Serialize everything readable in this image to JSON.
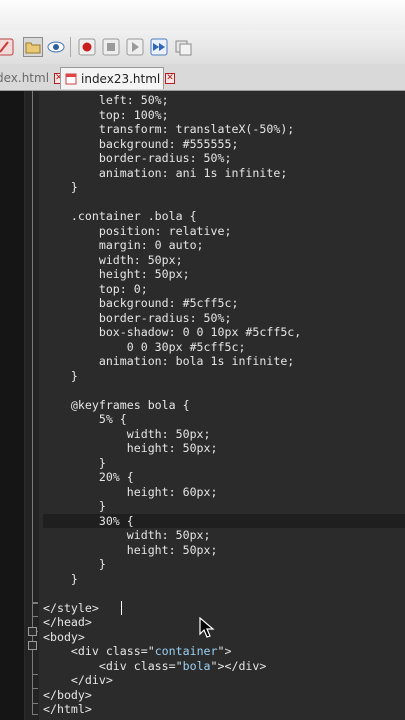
{
  "tabs": [
    {
      "label": "dex.html",
      "active": false,
      "icon": "html-file-icon"
    },
    {
      "label": "index23.html",
      "active": true,
      "icon": "html-file-icon"
    }
  ],
  "toolbar": {
    "icons": [
      "edit-icon",
      "open-folder-icon",
      "view-eye-icon",
      "record-icon",
      "stop-icon",
      "play-icon",
      "fast-forward-icon",
      "save-macro-icon"
    ]
  },
  "code_lines": [
    "        left: 50%;",
    "        top: 100%;",
    "        transform: translateX(-50%);",
    "        background: #555555;",
    "        border-radius: 50%;",
    "        animation: ani 1s infinite;",
    "    }",
    "",
    "    .container .bola {",
    "        position: relative;",
    "        margin: 0 auto;",
    "        width: 50px;",
    "        height: 50px;",
    "        top: 0;",
    "        background: #5cff5c;",
    "        border-radius: 50%;",
    "        box-shadow: 0 0 10px #5cff5c,",
    "            0 0 30px #5cff5c;",
    "        animation: bola 1s infinite;",
    "    }",
    "",
    "    @keyframes bola {",
    "        5% {",
    "            width: 50px;",
    "            height: 50px;",
    "        }",
    "        20% {",
    "            height: 60px;",
    "        }",
    "        30% {",
    "            width: 50px;",
    "            height: 50px;",
    "        }",
    "    }",
    "",
    "</style>",
    "</head>",
    "<body>",
    "    <div class=\"container\">",
    "        <div class=\"bola\"></div>",
    "    </div>",
    "</body>",
    "</html>"
  ],
  "current_line": 29,
  "colors": {
    "editor_bg": "#2b2b2b",
    "text": "#e6e6e6",
    "string": "#9ad0f0",
    "current_line": "#1f1f1f"
  }
}
